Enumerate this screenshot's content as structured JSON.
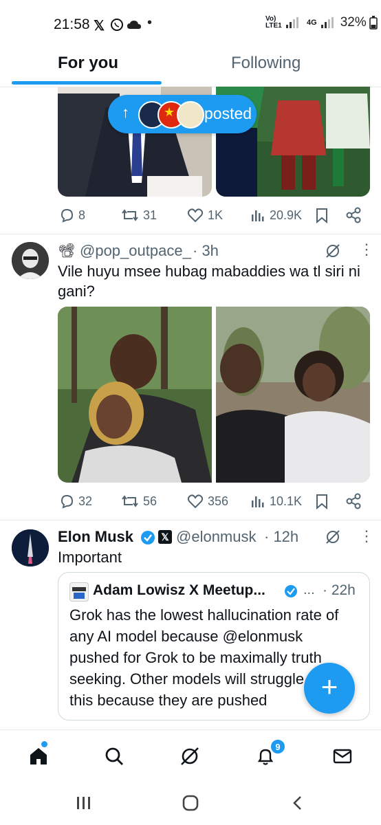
{
  "status_bar": {
    "time": "21:58",
    "network": "Vo) LTE1",
    "network_type": "4G",
    "battery": "32%"
  },
  "tabs": [
    {
      "label": "For you",
      "active": true
    },
    {
      "label": "Following",
      "active": false
    }
  ],
  "posted_pill": {
    "label": "posted"
  },
  "tweet1": {
    "replies": "8",
    "retweets": "31",
    "likes": "1K",
    "views": "20.9K"
  },
  "tweet2": {
    "handle": "@pop_outpace_",
    "time": "· 3h",
    "text": "Vile huyu msee hubag mabaddies wa tl siri ni gani?",
    "replies": "32",
    "retweets": "56",
    "likes": "356",
    "views": "10.1K"
  },
  "tweet3": {
    "name": "Elon Musk",
    "handle": "@elonmusk",
    "time": "· 12h",
    "text": "Important",
    "quote": {
      "name": "Adam Lowisz X Meetup...",
      "ellipsis": "...",
      "time": "· 22h",
      "text": "Grok has the lowest hallucination rate of any AI model because @elonmusk pushed for Grok to be maximally truth seeking. Other models will struggle with this because they are pushed"
    }
  },
  "notifications_badge": "9",
  "colors": {
    "accent": "#1d9bf0",
    "text": "#0f1419",
    "muted": "#536471",
    "divider": "#e6ecf0"
  }
}
